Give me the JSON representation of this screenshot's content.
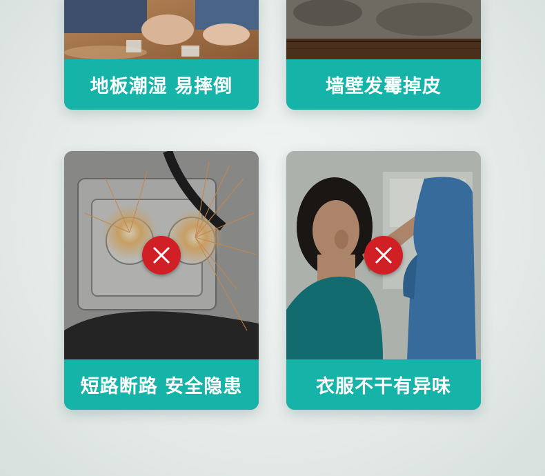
{
  "cards": [
    {
      "caption": "地板潮湿 易摔倒",
      "image": "wet-floor-feet-photo"
    },
    {
      "caption": "墙壁发霉掉皮",
      "image": "moldy-wall-photo"
    },
    {
      "caption": "短路断路 安全隐患",
      "image": "sparking-socket-photo",
      "badge_icon": "x-mark-icon"
    },
    {
      "caption": "衣服不干有异味",
      "image": "woman-smelling-shirt-photo",
      "badge_icon": "x-mark-icon"
    }
  ],
  "colors": {
    "caption_bg": "#16b3a8",
    "caption_text": "#ffffff",
    "badge_red": "#d11f26",
    "page_bg": "#e6ecea"
  }
}
